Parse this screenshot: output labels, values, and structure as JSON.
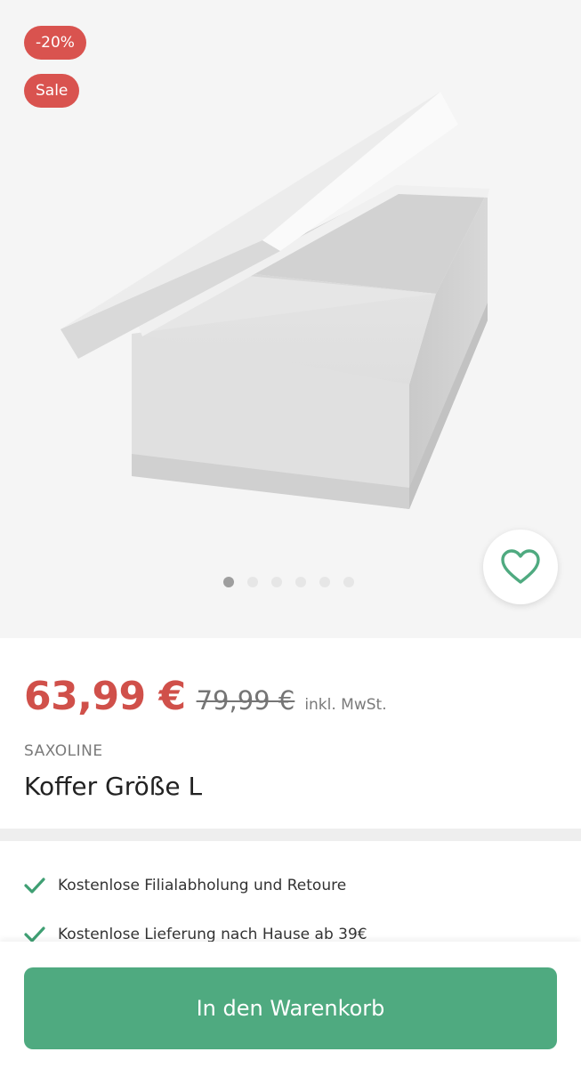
{
  "gallery": {
    "badges": [
      "-20%",
      "Sale"
    ],
    "image_alt": "Koffer Größe L",
    "slide_count": 6,
    "active_slide": 1
  },
  "product": {
    "price": "63,99 €",
    "old_price": "79,99 €",
    "vat_note": "inkl. MwSt.",
    "brand": "SAXOLINE",
    "title": "Koffer Größe L"
  },
  "benefits": [
    "Kostenlose Filialabholung und Retoure",
    "Kostenlose Lieferung nach Hause ab 39€"
  ],
  "cart": {
    "button_label": "In den Warenkorb"
  },
  "colors": {
    "sale_red": "#d9534f",
    "price_red": "#d0504a",
    "accent_green": "#4faa80",
    "check_green": "#3f9f73"
  },
  "icons": {
    "favorite": "heart-outline-icon",
    "benefit": "checkmark-icon"
  }
}
